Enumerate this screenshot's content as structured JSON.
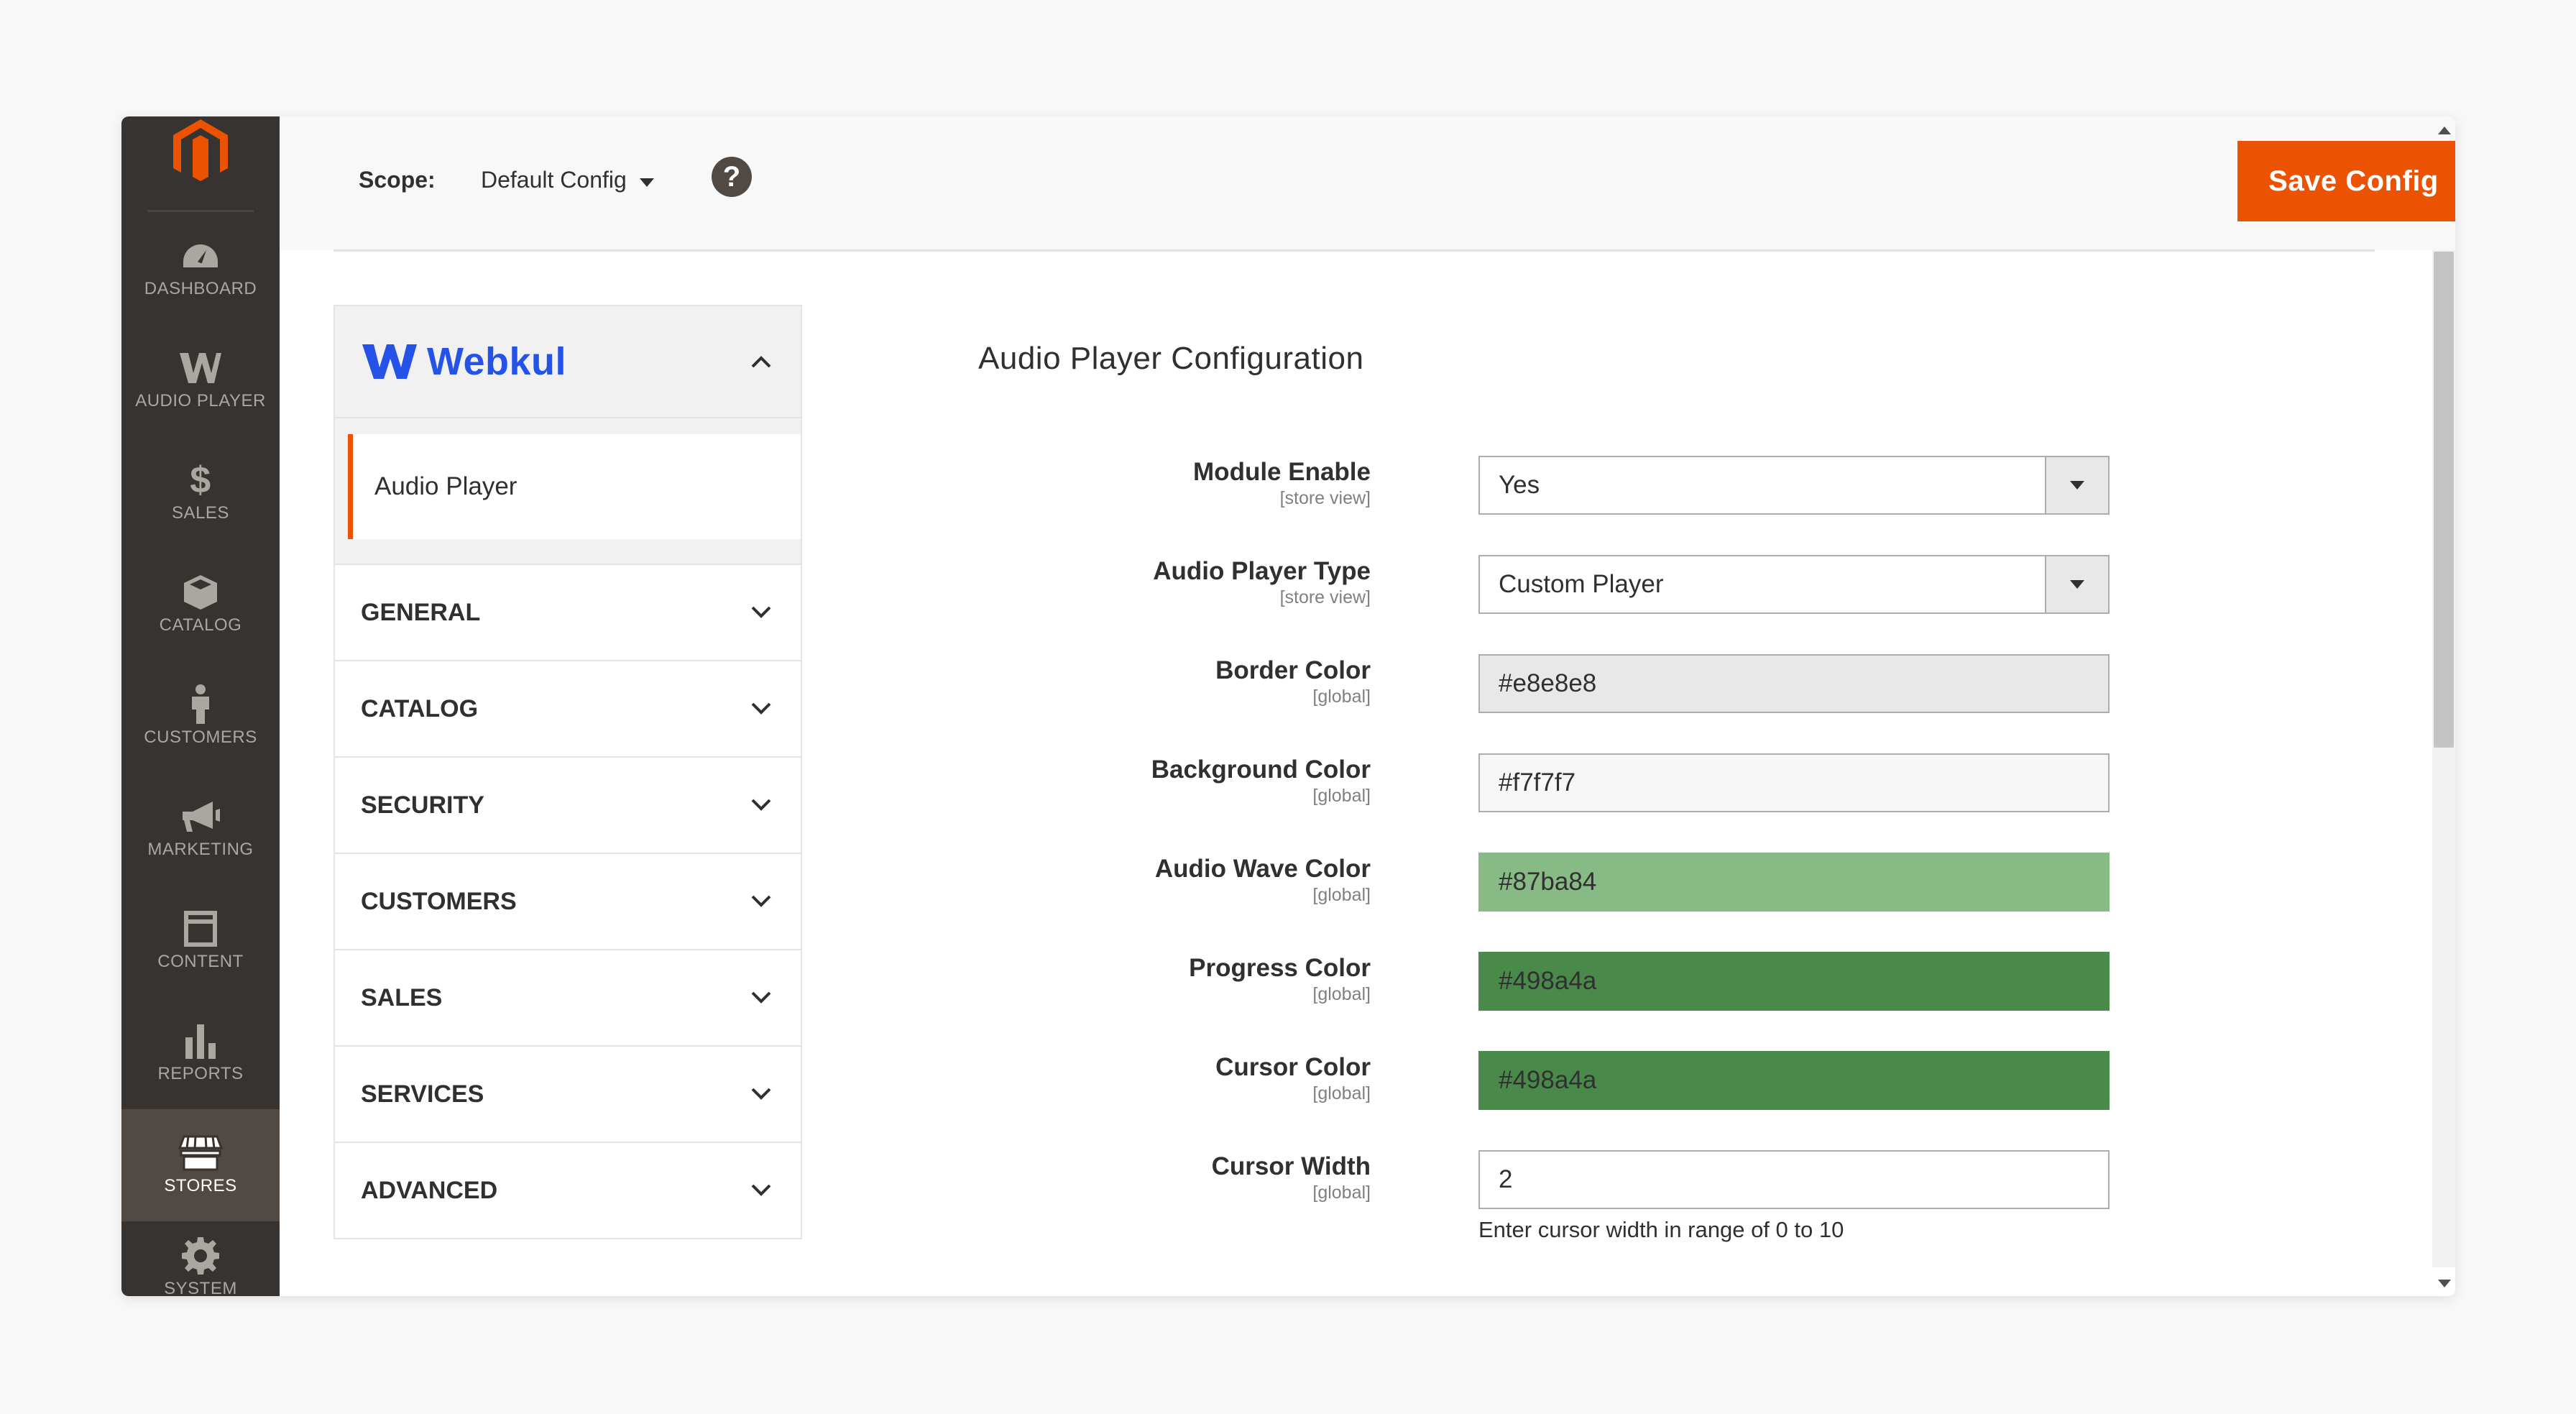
{
  "nav": {
    "items": [
      {
        "label": "DASHBOARD",
        "icon": "dashboard-icon"
      },
      {
        "label": "AUDIO PLAYER",
        "icon": "webkul-icon"
      },
      {
        "label": "SALES",
        "icon": "dollar-icon"
      },
      {
        "label": "CATALOG",
        "icon": "box-icon"
      },
      {
        "label": "CUSTOMERS",
        "icon": "person-icon"
      },
      {
        "label": "MARKETING",
        "icon": "megaphone-icon"
      },
      {
        "label": "CONTENT",
        "icon": "layout-icon"
      },
      {
        "label": "REPORTS",
        "icon": "bar-chart-icon"
      },
      {
        "label": "STORES",
        "icon": "store-icon"
      },
      {
        "label": "SYSTEM",
        "icon": "gear-icon"
      }
    ],
    "active": "STORES"
  },
  "header": {
    "scope_label": "Scope:",
    "scope_value": "Default Config",
    "help": "?",
    "save_label": "Save Config"
  },
  "config_nav": {
    "vendor": "Webkul",
    "vendor_item": "Audio Player",
    "sections": [
      "GENERAL",
      "CATALOG",
      "SECURITY",
      "CUSTOMERS",
      "SALES",
      "SERVICES",
      "ADVANCED"
    ]
  },
  "section": {
    "title": "Audio Player Configuration",
    "fields": [
      {
        "label": "Module Enable",
        "scope": "[store view]",
        "value": "Yes",
        "type": "select"
      },
      {
        "label": "Audio Player Type",
        "scope": "[store view]",
        "value": "Custom Player",
        "type": "select"
      },
      {
        "label": "Border Color",
        "scope": "[global]",
        "value": "#e8e8e8",
        "type": "color",
        "swatch": "#e8e8e8"
      },
      {
        "label": "Background Color",
        "scope": "[global]",
        "value": "#f7f7f7",
        "type": "color",
        "swatch": "#f7f7f7"
      },
      {
        "label": "Audio Wave Color",
        "scope": "[global]",
        "value": "#87ba84",
        "type": "color",
        "swatch": "#87ba84"
      },
      {
        "label": "Progress Color",
        "scope": "[global]",
        "value": "#498a4a",
        "type": "color",
        "swatch": "#498a4a"
      },
      {
        "label": "Cursor Color",
        "scope": "[global]",
        "value": "#498a4a",
        "type": "color",
        "swatch": "#498a4a"
      },
      {
        "label": "Cursor Width",
        "scope": "[global]",
        "value": "2",
        "type": "text"
      }
    ],
    "cursor_width_note": "Enter cursor width in range of 0 to 10"
  },
  "colors": {
    "accent": "#eb5202",
    "nav_bg": "#373330",
    "vendor_blue": "#2553e8"
  }
}
